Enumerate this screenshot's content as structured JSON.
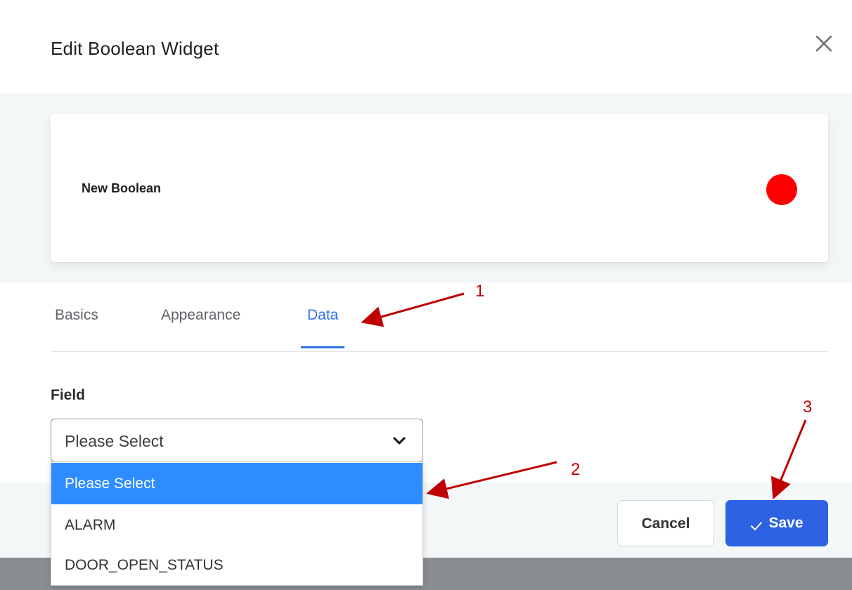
{
  "dialog": {
    "title": "Edit Boolean Widget",
    "close_icon": "close-icon"
  },
  "preview": {
    "widget_label": "New Boolean",
    "indicator_color": "#ff0000"
  },
  "tabs": [
    {
      "label": "Basics",
      "active": false
    },
    {
      "label": "Appearance",
      "active": false
    },
    {
      "label": "Data",
      "active": true
    }
  ],
  "field": {
    "label": "Field",
    "selected_value": "Please Select",
    "options": [
      "Please Select",
      "ALARM",
      "DOOR_OPEN_STATUS"
    ],
    "highlighted_option": "Please Select"
  },
  "buttons": {
    "cancel_label": "Cancel",
    "save_label": "Save",
    "save_icon": "check-icon"
  },
  "annotations": {
    "markers": [
      "1",
      "2",
      "3"
    ],
    "color": "#c00000"
  },
  "colors": {
    "accent": "#2f6fe4",
    "option_highlight": "#2d8cff",
    "save_button": "#2d63e3",
    "tab_active_text": "#2f6fe4"
  }
}
